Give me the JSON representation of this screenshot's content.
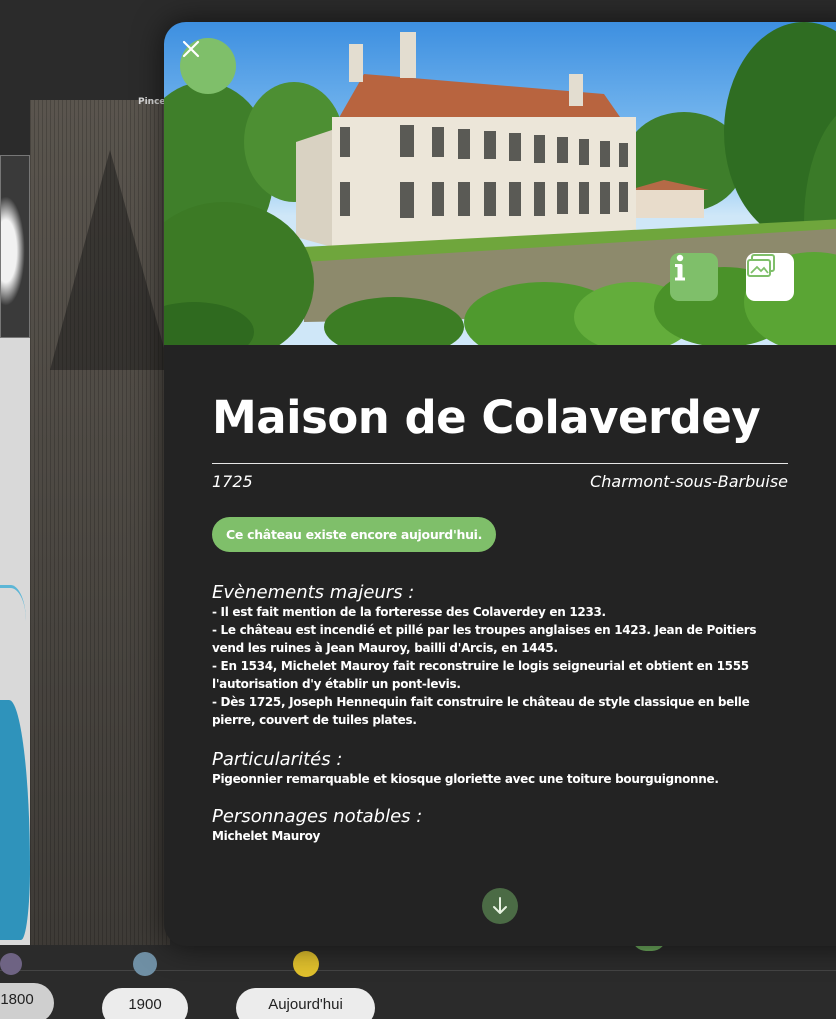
{
  "background": {
    "label_fragment": "Pince"
  },
  "timeline": {
    "buttons": [
      "1800",
      "1900",
      "Aujourd'hui"
    ],
    "dot_colors": [
      "#6e6383",
      "#6f8fa4",
      "#e1c12d",
      "#6fae5f"
    ]
  },
  "modal": {
    "close_icon": "close-icon",
    "info_icon": "info-icon",
    "gallery_icon": "gallery-icon",
    "scroll_icon": "arrow-down-icon",
    "accent_color": "#7fbf6a",
    "title": "Maison de Colaverdey",
    "year": "1725",
    "location": "Charmont-sous-Barbuise",
    "status_badge": "Ce château existe encore aujourd'hui.",
    "sections": {
      "events": {
        "title": "Evènements majeurs :",
        "lines": [
          "- Il est fait mention de la forteresse des Colaverdey en 1233.",
          "- Le château est incendié et pillé par les troupes anglaises en 1423. Jean de Poitiers vend les ruines à Jean Mauroy, bailli d'Arcis, en 1445.",
          "- En 1534, Michelet Mauroy fait reconstruire le logis seigneurial et obtient en 1555 l'autorisation d'y établir un pont-levis.",
          "- Dès 1725, Joseph Hennequin fait construire le château de style classique en belle pierre, couvert de tuiles plates."
        ]
      },
      "particularities": {
        "title": "Particularités :",
        "text": "Pigeonnier remarquable et kiosque gloriette avec une toiture bourguignonne."
      },
      "people": {
        "title": "Personnages notables :",
        "text": "Michelet Mauroy"
      }
    }
  }
}
